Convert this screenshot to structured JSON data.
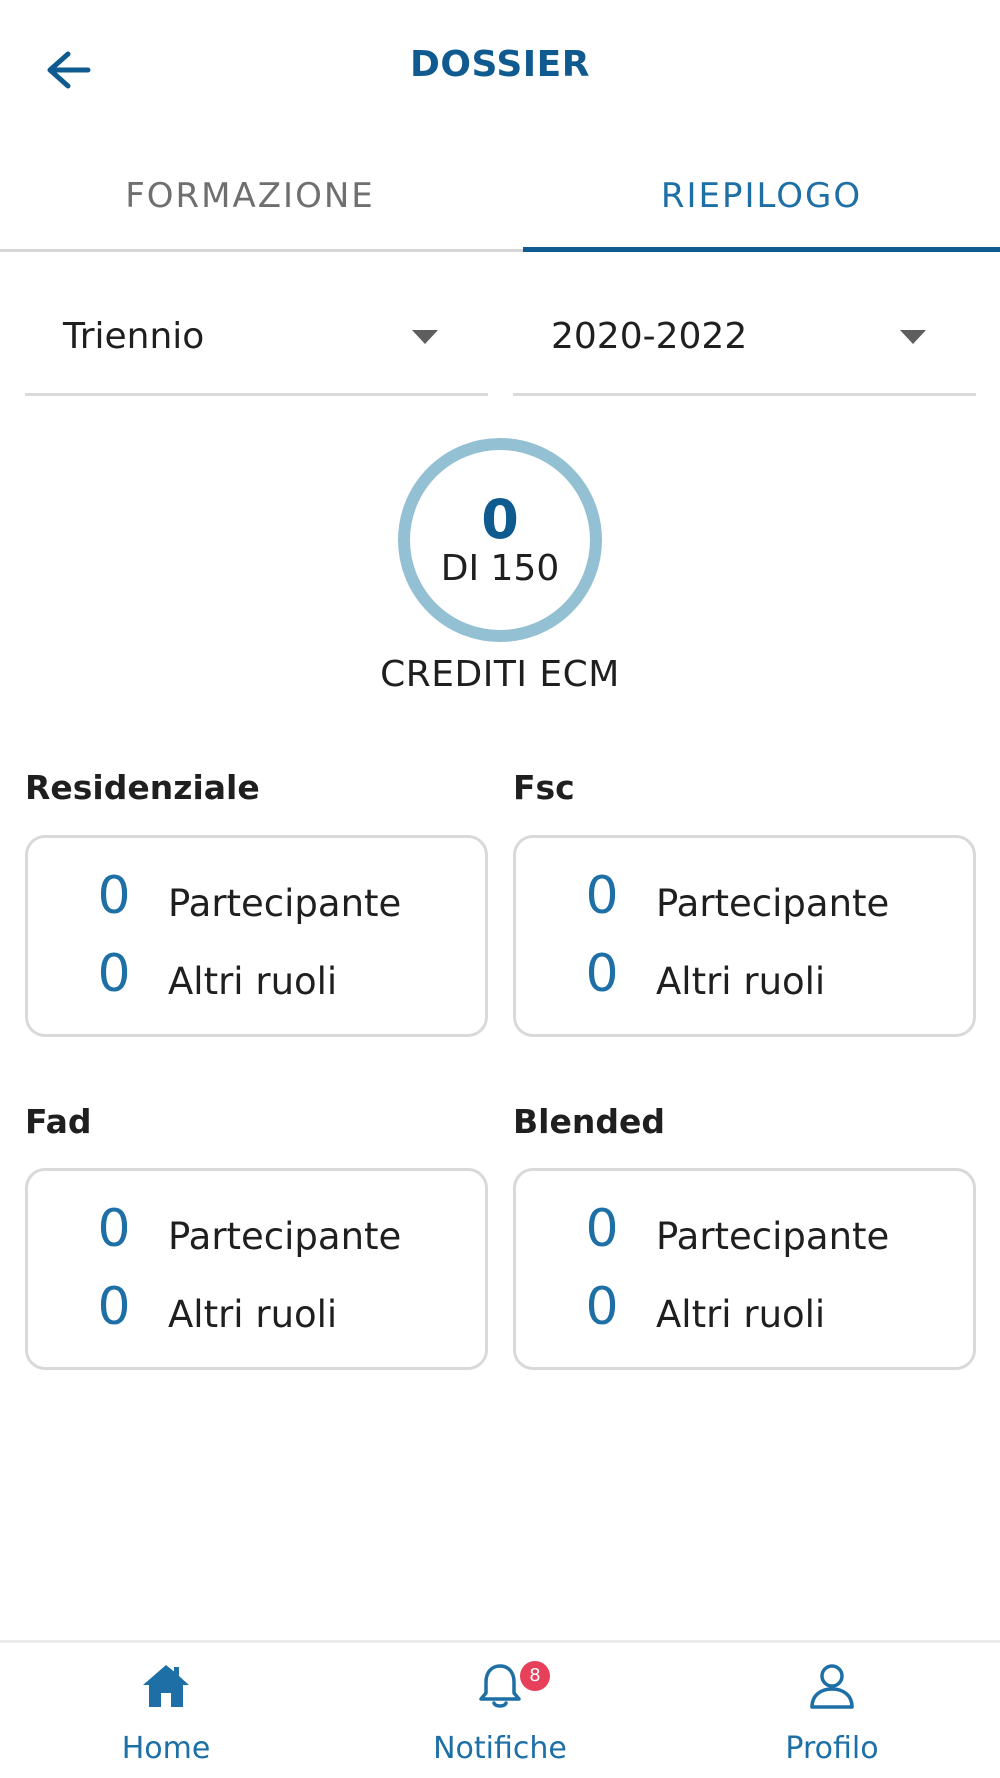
{
  "header": {
    "title": "DOSSIER",
    "back_icon": "arrow-left-icon"
  },
  "tabs": [
    {
      "label": "FORMAZIONE",
      "active": false
    },
    {
      "label": "RIEPILOGO",
      "active": true
    }
  ],
  "filters": {
    "period_type": "Triennio",
    "period_range": "2020-2022"
  },
  "credits": {
    "value": "0",
    "total": "DI 150",
    "label": "CREDITI ECM",
    "ring_color": "#94c0d4"
  },
  "sections": [
    {
      "title": "Residenziale",
      "rows": [
        {
          "value": "0",
          "label": "Partecipante"
        },
        {
          "value": "0",
          "label": "Altri ruoli"
        }
      ]
    },
    {
      "title": "Fsc",
      "rows": [
        {
          "value": "0",
          "label": "Partecipante"
        },
        {
          "value": "0",
          "label": "Altri ruoli"
        }
      ]
    },
    {
      "title": "Fad",
      "rows": [
        {
          "value": "0",
          "label": "Partecipante"
        },
        {
          "value": "0",
          "label": "Altri ruoli"
        }
      ]
    },
    {
      "title": "Blended",
      "rows": [
        {
          "value": "0",
          "label": "Partecipante"
        },
        {
          "value": "0",
          "label": "Altri ruoli"
        }
      ]
    }
  ],
  "bottom_nav": [
    {
      "label": "Home",
      "icon": "home-icon"
    },
    {
      "label": "Notifiche",
      "icon": "bell-icon",
      "badge": "8"
    },
    {
      "label": "Profilo",
      "icon": "user-icon"
    }
  ],
  "colors": {
    "primary": "#0f5a8e",
    "accent": "#1d6fa6",
    "badge": "#e6405a"
  }
}
